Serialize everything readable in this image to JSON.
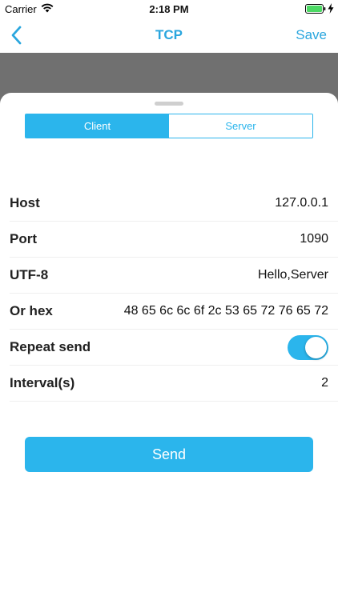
{
  "status_bar": {
    "carrier": "Carrier",
    "time": "2:18 PM",
    "battery_color": "#4cd964"
  },
  "nav": {
    "title": "TCP",
    "save_label": "Save",
    "accent_color": "#2aa6de"
  },
  "segment": {
    "options": [
      "Client",
      "Server"
    ],
    "selected": "Client"
  },
  "fields": {
    "host": {
      "label": "Host",
      "value": "127.0.0.1"
    },
    "port": {
      "label": "Port",
      "value": "1090"
    },
    "utf8": {
      "label": "UTF-8",
      "value": "Hello,Server"
    },
    "hex": {
      "label": "Or hex",
      "value": "48 65 6c 6c 6f 2c 53 65 72 76 65 72"
    },
    "repeat": {
      "label": "Repeat send",
      "enabled": true
    },
    "interval": {
      "label": "Interval(s)",
      "value": "2"
    }
  },
  "send_label": "Send"
}
